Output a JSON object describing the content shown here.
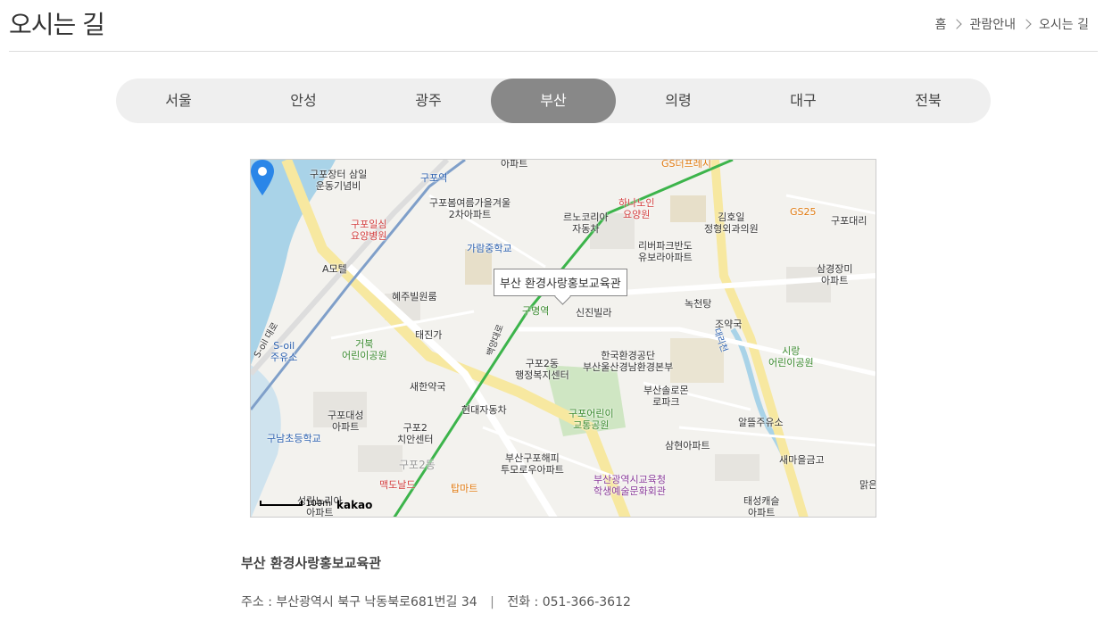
{
  "header": {
    "title": "오시는 길",
    "breadcrumb": [
      "홈",
      "관람안내",
      "오시는 길"
    ]
  },
  "tabs": [
    {
      "label": "서울",
      "active": false
    },
    {
      "label": "안성",
      "active": false
    },
    {
      "label": "광주",
      "active": false
    },
    {
      "label": "부산",
      "active": true
    },
    {
      "label": "의령",
      "active": false
    },
    {
      "label": "대구",
      "active": false
    },
    {
      "label": "전북",
      "active": false
    }
  ],
  "map": {
    "info_window": "부산 환경사랑홍보교육관",
    "scale": "100m",
    "logo": "kakao",
    "labels": {
      "l1": "구포장터 삼일\n운동기념비",
      "l2": "구포역",
      "l3": "아파트",
      "l4": "GS더프레시",
      "l5": "구포일심\n요양병원",
      "l6": "구포봄여름가을겨울\n2차아파트",
      "l7": "하나노인\n요양원",
      "l8": "김호일\n정형외과의원",
      "l9": "GS25",
      "l10": "구포대리",
      "l11": "르노코리아\n자동차",
      "l12": "가람중학교",
      "l13": "리버파크반도\n유보라아파트",
      "l14": "A모텔",
      "l15": "삼경장미\n아파트",
      "l16": "혜주빌원룸",
      "l17": "구명역",
      "l18": "신진빌라",
      "l19": "녹천탕",
      "l20": "조약국",
      "l21": "S-oil\n주유소",
      "l22": "거북\n어린이공원",
      "l23": "태진가",
      "l24": "한국환경공단\n부산울산경남환경본부",
      "l25": "구포2동\n행정복지센터",
      "l26": "새한약국",
      "l27": "시랑\n어린이공원",
      "l28": "부산솔로몬\n로파크",
      "l29": "구포어린이\n교통공원",
      "l30": "구포대성\n아파트",
      "l31": "현대자동차",
      "l32": "알뜰주유소",
      "l33": "구포2\n치안센터",
      "l34": "구남초등학교",
      "l35": "삼현아파트",
      "l36": "구포2동",
      "l37": "부산구포해피\n투모로우아파트",
      "l38": "새마을금고",
      "l39": "부산광역시교육청\n학생예술문화회관",
      "l40": "맥도날드",
      "l41": "탑마트",
      "l42": "맑은",
      "l43": "태성캐슬\n아파트",
      "l44": "성림노리아\n아파트",
      "l45": "대리천",
      "l46": "백양대로",
      "l47": "S-oil 대로"
    }
  },
  "place": {
    "name": "부산 환경사랑홍보교육관",
    "address": "주소 : 부산광역시 북구 낙동북로681번길 34",
    "phone": "전화 : 051-366-3612"
  },
  "colors": {
    "tab_active": "#888888",
    "tab_bg": "#efefef",
    "road_major": "#f7e8a0",
    "water": "#a9d3e8",
    "park": "#cfe6c3",
    "rail_green": "#3cb44b"
  }
}
